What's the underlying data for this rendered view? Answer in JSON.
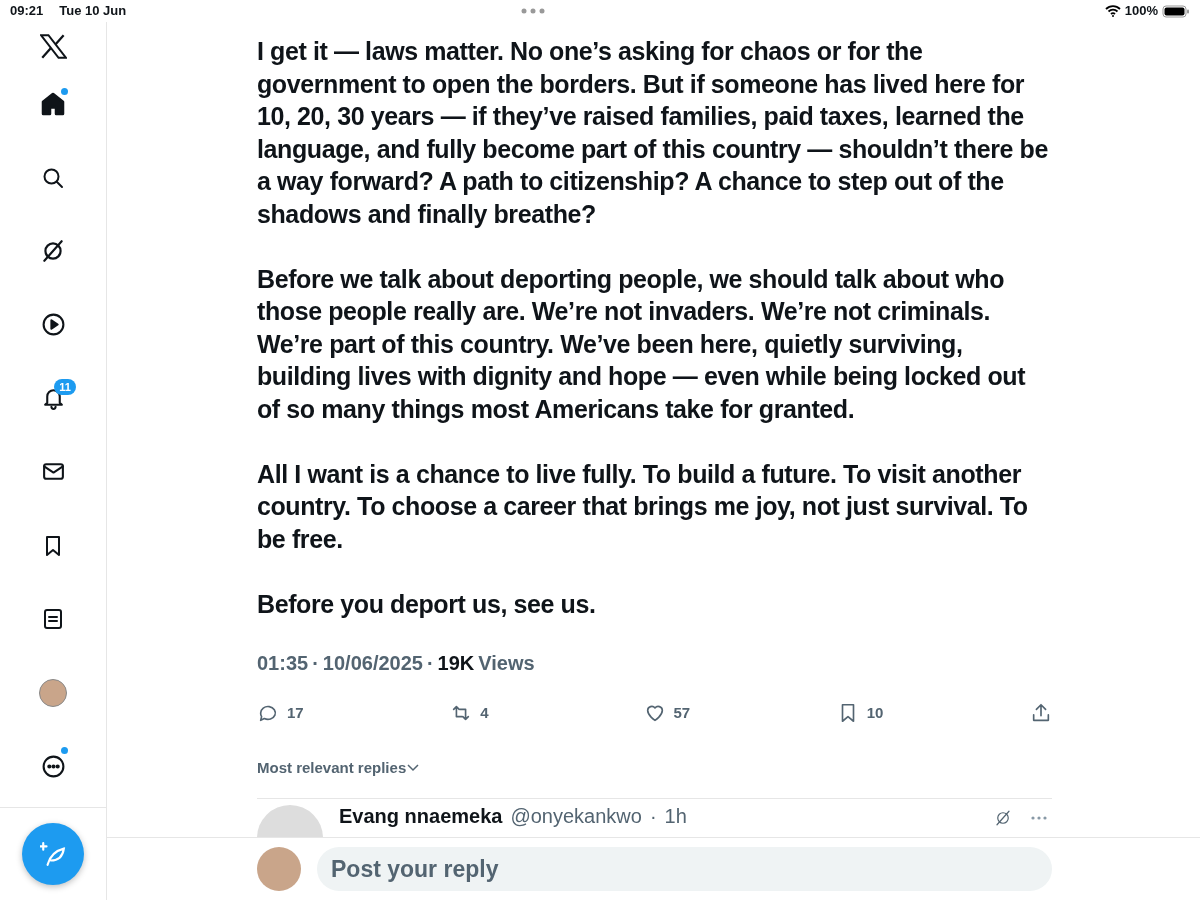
{
  "status_bar": {
    "time": "09:21",
    "date": "Tue 10 Jun",
    "battery": "100%"
  },
  "sidebar": {
    "items": [
      {
        "kind": "home",
        "selected": true,
        "dot": true
      },
      {
        "kind": "search",
        "selected": false,
        "dot": false
      },
      {
        "kind": "grok",
        "selected": false,
        "dot": false
      },
      {
        "kind": "video",
        "selected": false,
        "dot": false
      },
      {
        "kind": "notifications",
        "selected": false,
        "dot": false,
        "badge": "11"
      },
      {
        "kind": "messages",
        "selected": false,
        "dot": false
      },
      {
        "kind": "bookmarks",
        "selected": false,
        "dot": false
      },
      {
        "kind": "lists",
        "selected": false,
        "dot": false
      },
      {
        "kind": "profile",
        "selected": false,
        "dot": false
      },
      {
        "kind": "more",
        "selected": false,
        "dot": true
      }
    ]
  },
  "post": {
    "paragraphs": [
      "I get it — laws matter. No one’s asking for chaos or for the government to open the borders. But if someone has lived here for 10, 20, 30 years — if they’ve raised families, paid taxes, learned the language, and fully become part of this country — shouldn’t there be a way forward? A path to citizenship? A chance to step out of the shadows and finally breathe?",
      "Before we talk about deporting people, we should talk about who those people really are. We’re not invaders. We’re not criminals. We’re part of this country. We’ve been here, quietly surviving, building lives with dignity and hope — even while being locked out of so many things most Americans take for granted.",
      "All I want is a chance to live fully. To build a future. To visit another country. To choose a career that brings me joy, not just survival. To be free.",
      "Before you deport us, see us."
    ],
    "time": "01:35",
    "separator": "·",
    "date": "10/06/2025",
    "views_count": "19K",
    "views_label": "Views",
    "actions": [
      {
        "kind": "reply",
        "count": "17"
      },
      {
        "kind": "repost",
        "count": "4"
      },
      {
        "kind": "like",
        "count": "57"
      },
      {
        "kind": "bookmark",
        "count": "10"
      },
      {
        "kind": "share"
      }
    ],
    "sort_label": "Most relevant replies"
  },
  "reply": {
    "name": "Evang nnaemeka",
    "handle": "@onyekankwo",
    "separator": "·",
    "time": "1h"
  },
  "composer": {
    "placeholder": "Post your reply"
  }
}
